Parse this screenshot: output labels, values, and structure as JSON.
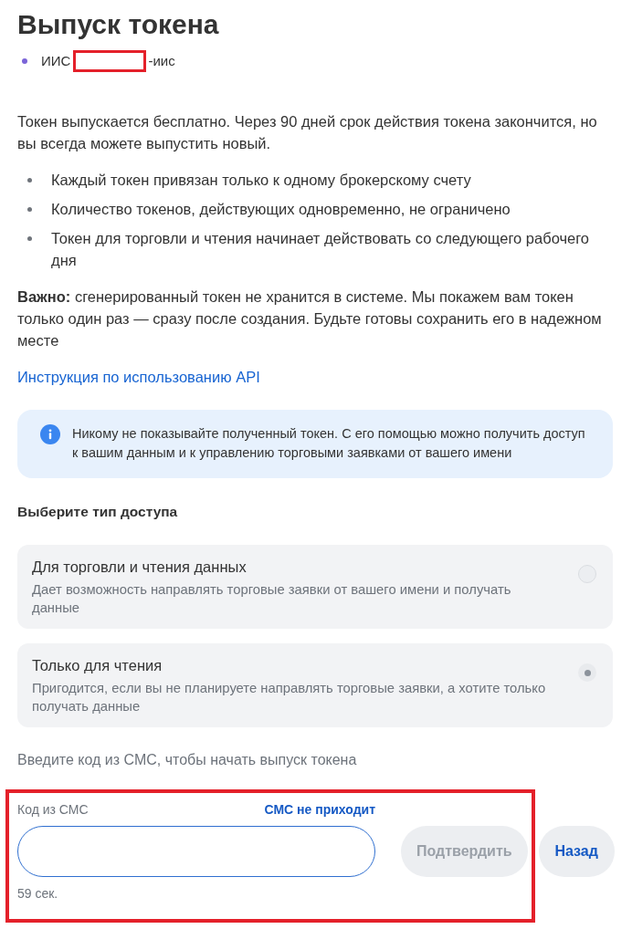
{
  "page": {
    "title": "Выпуск токена"
  },
  "account": {
    "name_start": "ИИС",
    "name_end": "-иис",
    "redacted": true
  },
  "intro": {
    "text": "Токен выпускается бесплатно. Через 90 дней срок действия токена закончится, но вы всегда можете выпустить новый.",
    "points": [
      "Каждый токен привязан только к одному брокерскому счету",
      "Количество токенов, действующих одновременно, не ограничено",
      "Токен для торговли и чтения начинает действовать со следующего рабочего дня"
    ]
  },
  "important": "**Важно:** сгенерированный токен не хранится в системе. Мы покажем вам токен только один раз — сразу после создания. Будьте готовы сохранить его в надежном месте",
  "api_link": "Инструкция по использованию API",
  "alert": {
    "kind": "info",
    "text": "Никому не показывайте полученный токен. С его помощью можно получить доступ к вашим данным и к управлению торговыми заявками от вашего имени"
  },
  "access": {
    "heading": "Выберите тип доступа",
    "options": [
      {
        "title": "Для торговли и чтения данных",
        "description": "Дает возможность направлять торговые заявки от вашего имени и получать данные",
        "selected": false
      },
      {
        "title": "Только для чтения",
        "description": "Пригодится, если вы не планируете направлять торговые заявки, а хотите только получать данные",
        "selected": true
      }
    ]
  },
  "sms": {
    "prompt": "Введите код из СМС, чтобы начать выпуск токена",
    "highlighted": true,
    "label": "Код из СМС",
    "help_link": "СМС не приходит",
    "confirm": {
      "label": "Подтвердить",
      "disabled": true
    },
    "back": {
      "label": "Назад"
    },
    "timer": "59 сек."
  }
}
